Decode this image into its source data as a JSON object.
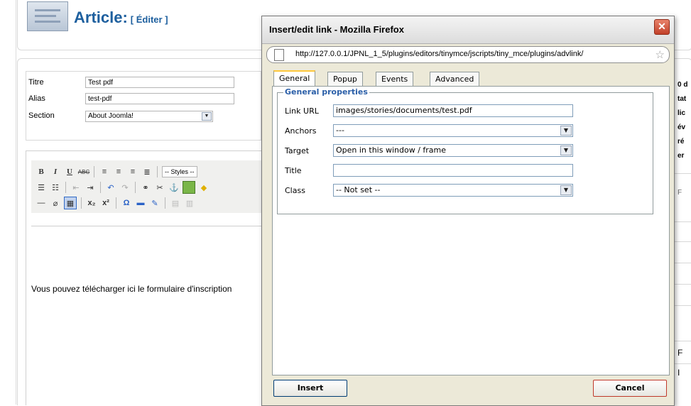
{
  "article": {
    "title": "Article:",
    "edit": "[ Éditer ]"
  },
  "form": {
    "title_label": "Titre",
    "title_value": "Test pdf",
    "alias_label": "Alias",
    "alias_value": "test-pdf",
    "section_label": "Section",
    "section_value": "About Joomla!"
  },
  "editor": {
    "styles_label": "-- Styles --",
    "body_text": "Vous pouvez télécharger ici le formulaire d'inscription"
  },
  "right_fragments": [
    "0 d",
    "tat",
    "lic",
    "év",
    "ré",
    "er",
    "F",
    "F",
    "I"
  ],
  "popup": {
    "title": "Insert/edit link - Mozilla Firefox",
    "url": "http://127.0.0.1/JPNL_1_5/plugins/editors/tinymce/jscripts/tiny_mce/plugins/advlink/",
    "tabs": [
      "General",
      "Popup",
      "Events",
      "Advanced"
    ],
    "legend": "General properties",
    "fields": {
      "link_url_label": "Link URL",
      "link_url_value": "images/stories/documents/test.pdf",
      "anchors_label": "Anchors",
      "anchors_value": "---",
      "target_label": "Target",
      "target_value": "Open in this window / frame",
      "title_label": "Title",
      "title_value": "",
      "class_label": "Class",
      "class_value": "-- Not set --"
    },
    "insert_label": "Insert",
    "cancel_label": "Cancel"
  },
  "colors": {
    "title_blue": "#1d5f9e",
    "legend_blue": "#2b5fa8",
    "tab_highlight": "#ffc83c",
    "close_red": "#c2412a"
  }
}
